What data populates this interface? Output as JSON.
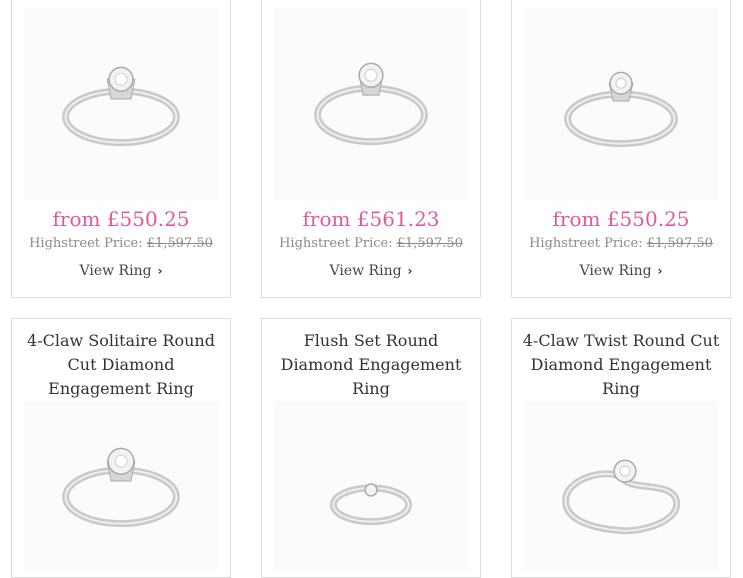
{
  "top_row": [
    {
      "price": "from £550.25",
      "highstreet_label": "Highstreet Price:",
      "highstreet_price": "£1,597.50",
      "view_label": "View Ring"
    },
    {
      "price": "from £561.23",
      "highstreet_label": "Highstreet Price:",
      "highstreet_price": "£1,597.50",
      "view_label": "View Ring"
    },
    {
      "price": "from £550.25",
      "highstreet_label": "Highstreet Price:",
      "highstreet_price": "£1,597.50",
      "view_label": "View Ring"
    }
  ],
  "bottom_row": [
    {
      "title": "4-Claw Solitaire Round Cut Diamond Engagement Ring"
    },
    {
      "title": "Flush Set Round Diamond Engagement Ring"
    },
    {
      "title": "4-Claw Twist Round Cut Diamond Engagement Ring"
    }
  ],
  "icons": {
    "view_chevron": "chevron-right-icon",
    "product_image": "ring-image"
  }
}
